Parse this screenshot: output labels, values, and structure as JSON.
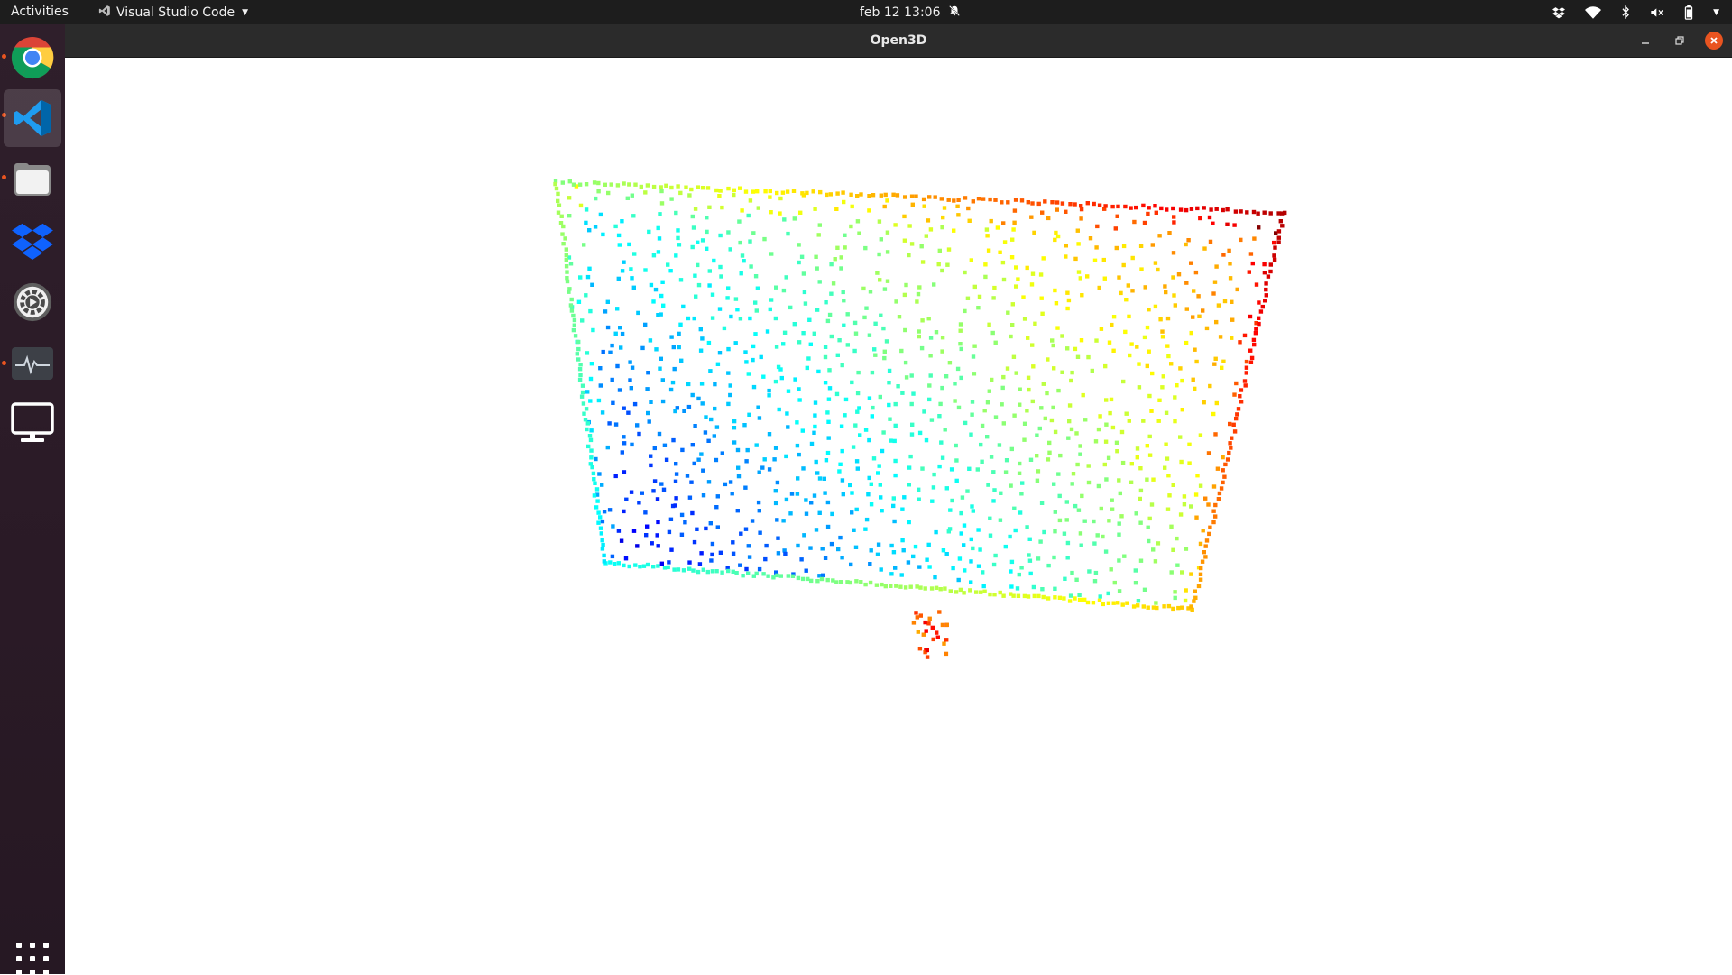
{
  "topbar": {
    "activities_label": "Activities",
    "app_name": "Visual Studio Code",
    "datetime": "feb 12  13:06"
  },
  "dock": {
    "items": [
      {
        "name": "Google Chrome",
        "icon": "chrome-icon",
        "running": true,
        "active": false
      },
      {
        "name": "Visual Studio Code",
        "icon": "vscode-icon",
        "running": true,
        "active": true
      },
      {
        "name": "Files",
        "icon": "files-icon",
        "running": true,
        "active": false
      },
      {
        "name": "Dropbox",
        "icon": "dropbox-icon",
        "running": false,
        "active": false
      },
      {
        "name": "Settings",
        "icon": "settings-icon",
        "running": false,
        "active": false
      },
      {
        "name": "System Monitor",
        "icon": "system-monitor-icon",
        "running": true,
        "active": false
      },
      {
        "name": "Remote Desktop",
        "icon": "monitor-icon",
        "running": false,
        "active": false
      }
    ],
    "show_apps_icon": "apps-grid-icon"
  },
  "window": {
    "title": "Open3D"
  },
  "colors": {
    "accent": "#e95420",
    "topbar": "#1d1d1d",
    "dock": "#2c1b28",
    "titlebar": "#2b2b2b",
    "viewer_bg": "#ffffff",
    "colormap": "jet"
  }
}
